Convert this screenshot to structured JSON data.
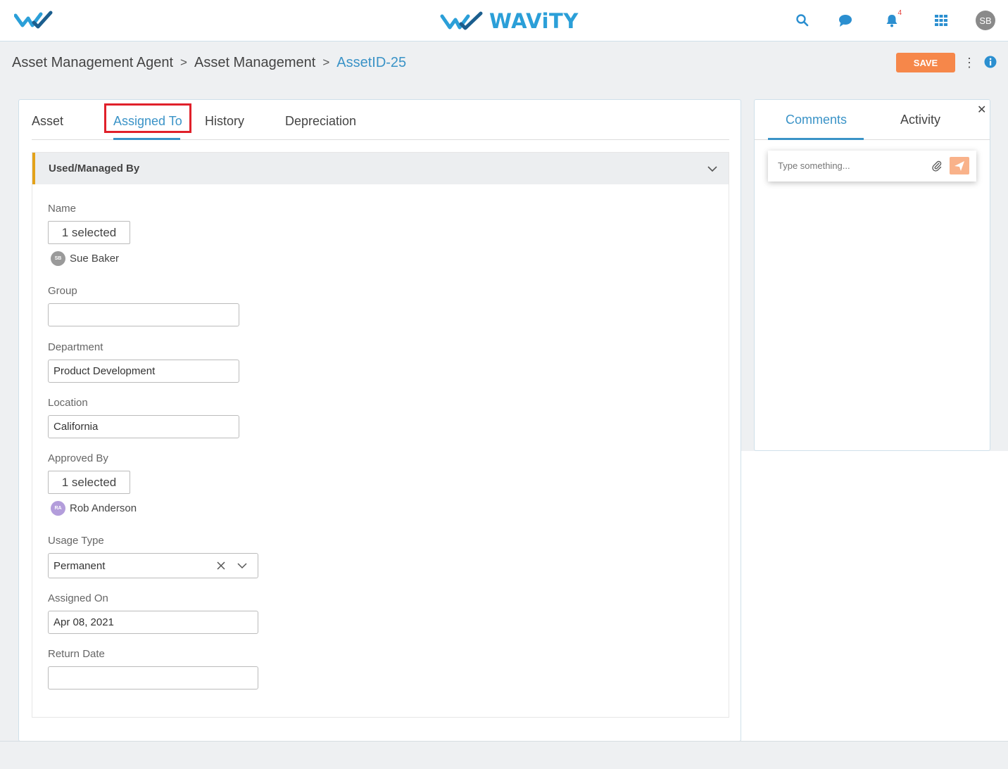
{
  "app": {
    "brand_name": "WAViTY",
    "brand_color": "#2b9fd8",
    "accent_color": "#3a93c7",
    "notifications_count": "4",
    "user_initials": "SB"
  },
  "breadcrumb": {
    "item1": "Asset Management Agent",
    "item2": "Asset Management",
    "current": "AssetID-25",
    "separator": ">"
  },
  "toolbar": {
    "save_label": "SAVE",
    "more_label": "⋮"
  },
  "tabs": [
    {
      "label": "Asset",
      "active": false
    },
    {
      "label": "Assigned To",
      "active": true
    },
    {
      "label": "History",
      "active": false
    },
    {
      "label": "Depreciation",
      "active": false
    }
  ],
  "section": {
    "title": "Used/Managed By"
  },
  "fields": {
    "name": {
      "label": "Name",
      "button": "1 selected",
      "person_name": "Sue Baker",
      "person_initials": "SB"
    },
    "group": {
      "label": "Group",
      "value": ""
    },
    "department": {
      "label": "Department",
      "value": "Product Development"
    },
    "location": {
      "label": "Location",
      "value": "California"
    },
    "approved_by": {
      "label": "Approved By",
      "button": "1 selected",
      "person_name": "Rob Anderson",
      "person_initials": "RA"
    },
    "usage_type": {
      "label": "Usage Type",
      "value": "Permanent"
    },
    "assigned_on": {
      "label": "Assigned On",
      "value": "Apr 08, 2021"
    },
    "return_date": {
      "label": "Return Date",
      "value": ""
    }
  },
  "side_panel": {
    "tabs": [
      {
        "label": "Comments",
        "active": true
      },
      {
        "label": "Activity",
        "active": false
      }
    ],
    "close_label": "✕",
    "comment_placeholder": "Type something..."
  }
}
